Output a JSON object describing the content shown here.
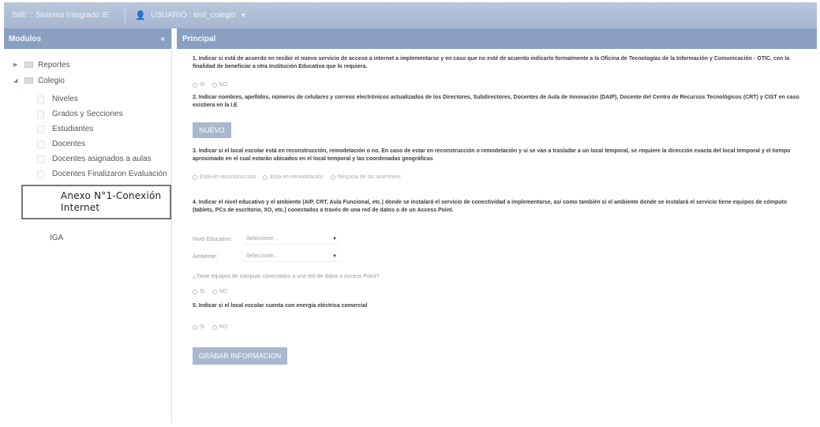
{
  "topbar": {
    "app_title": "SIIE :: Sistema Integrado IE",
    "user_label": "USUARIO : test_colegio"
  },
  "sidebar": {
    "header": "Modulos",
    "collapse_icon": "«",
    "tree": [
      {
        "label": "Reportes",
        "expanded": false
      },
      {
        "label": "Colegio",
        "expanded": true
      }
    ],
    "items": [
      {
        "label": "Niveles"
      },
      {
        "label": "Grados y Secciones"
      },
      {
        "label": "Estudiantes"
      },
      {
        "label": "Docentes"
      },
      {
        "label": "Docentes asignados a aulas"
      },
      {
        "label": "Docentes Finalizaron Evaluación"
      },
      {
        "label": "Anexo N°1-Conexión Internet"
      },
      {
        "label": "IGA"
      }
    ]
  },
  "main": {
    "header": "Principal",
    "q1": "1. Indicar si está de acuerdo en recibir el nuevo servicio de acceso a internet a implementarse y en caso que no esté de acuerdo indicarlo formalmente a la Oficina de Tecnologías de la Información y Comunicación - OTIC, con la finalidad de beneficiar a otra Institución Educativa que lo requiera.",
    "q1_options": [
      "SI",
      "NO"
    ],
    "q2": "2. Indicar nombres, apellidos, números de celulares y correos electrónicos actualizados de los Directores, Subdirectores, Docentes de Aula de Innovación (DAIP), Docente del Centro de Recursos Tecnológicos (CRT) y CIST en caso existiera en la I.E",
    "nuevo_button": "NUEVO",
    "q3": "3. Indicar si el local escolar está en reconstrucción, remodelación o no. En caso de estar en reconstrucción o remodelación y si se van a trasladar a un local temporal, se requiere la dirección exacta del local temporal y el tiempo aproximado en el cual estarán ubicados en el local temporal y las coordenadas geográficas",
    "q3_options": [
      "Está en reconstrucción",
      "Está en remodelación",
      "Ninguna de las anteriores"
    ],
    "q4": "4. Indicar el nivel educativo y el ambiente (AIP, CRT, Aula Funcional, etc.) donde se instalará el servicio de conectividad a implementarse, así como también si el ambiente donde se instalará el servicio tiene equipos de cómputo (tablets, PCs de escritorio, XO, etc.) conectados a través de una red de datos o de un Access Point.",
    "nivel_label": "Nivel Educativo:",
    "nivel_placeholder": "Seleccione...",
    "ambiente_label": "Ambiente:",
    "ambiente_placeholder": "Seleccione...",
    "q4b": "¿Tiene equipos de cómputo conectados a una red de datos o Access Point?",
    "q4b_options": [
      "SI",
      "NO"
    ],
    "q5": "5. Indicar si el local escolar cuenta con energía eléctrica comercial",
    "q5_options": [
      "SI",
      "NO"
    ],
    "save_button": "GRABAR INFORMACION"
  }
}
